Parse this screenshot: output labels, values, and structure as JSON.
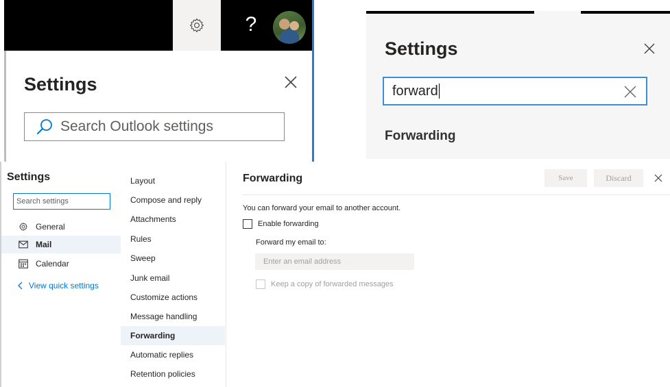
{
  "top_left_panel": {
    "title": "Settings",
    "search": {
      "placeholder": "Search Outlook settings"
    },
    "header_icons": [
      "gear-icon",
      "help-icon",
      "avatar"
    ],
    "help_glyph": "?"
  },
  "top_right_panel": {
    "title": "Settings",
    "search": {
      "value": "forward"
    },
    "result": "Forwarding"
  },
  "settings_panel": {
    "title": "Settings",
    "search": {
      "placeholder": "Search settings"
    },
    "nav": [
      {
        "label": "General",
        "icon": "gear-icon"
      },
      {
        "label": "Mail",
        "icon": "mail-icon",
        "selected": true
      },
      {
        "label": "Calendar",
        "icon": "calendar-icon"
      }
    ],
    "view_quick_settings": "View quick settings",
    "mail_subitems": [
      "Layout",
      "Compose and reply",
      "Attachments",
      "Rules",
      "Sweep",
      "Junk email",
      "Customize actions",
      "Message handling",
      "Forwarding",
      "Automatic replies",
      "Retention policies"
    ],
    "active_subitem": "Forwarding",
    "forwarding": {
      "heading": "Forwarding",
      "save_label": "Save",
      "discard_label": "Discard",
      "description": "You can forward your email to another account.",
      "enable_label": "Enable forwarding",
      "forward_to_label": "Forward my email to:",
      "email_placeholder": "Enter an email address",
      "keep_copy_label": "Keep a copy of forwarded messages"
    }
  },
  "colors": {
    "accent": "#0078d4",
    "search_focus": "#3a8fd8",
    "selected_bg": "#eef3fa"
  }
}
